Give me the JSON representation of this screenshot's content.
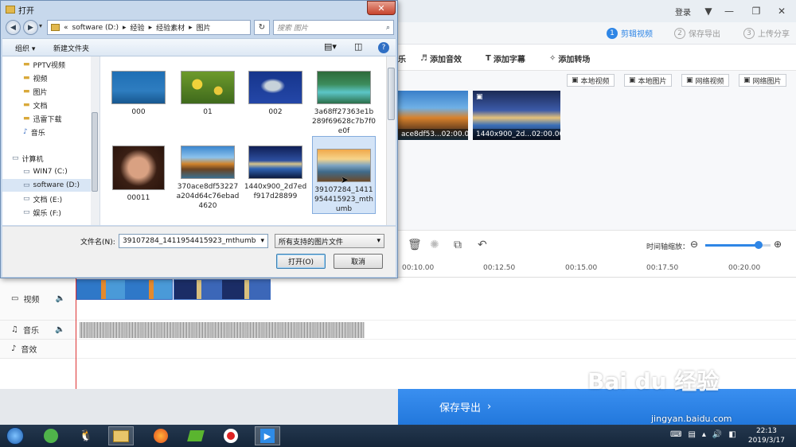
{
  "app": {
    "login": "登录",
    "steps": [
      {
        "num": "1",
        "label": "剪辑视频",
        "active": true
      },
      {
        "num": "2",
        "label": "保存导出",
        "active": false
      },
      {
        "num": "3",
        "label": "上传分享",
        "active": false
      }
    ],
    "tools": {
      "partial": "乐",
      "audio": "添加音效",
      "subtitle": "添加字幕",
      "transition": "添加转场"
    },
    "sources": [
      "本地视频",
      "本地图片",
      "网络视频",
      "网络图片"
    ],
    "media": [
      {
        "name": "ace8df53...",
        "duration": "02:00.00"
      },
      {
        "name": "1440x900_2d...",
        "duration": "02:00.00"
      }
    ],
    "zoom_label": "时间轴缩放：",
    "zoom_level": 0.82,
    "ruler": [
      "00:10.00",
      "00:12.50",
      "00:15.00",
      "00:17.50",
      "00:20.00"
    ],
    "tracks": {
      "video": "视频",
      "music": "音乐",
      "sfx": "音效"
    },
    "save_export": "保存导出"
  },
  "dialog": {
    "title": "打开",
    "path": [
      "software (D:)",
      "经验",
      "经验素材",
      "图片"
    ],
    "search_placeholder": "搜索 图片",
    "organize": "组织 ▾",
    "new_folder": "新建文件夹",
    "nav": [
      {
        "label": "PPTV视频",
        "icon": "folder-icon",
        "type": "fav"
      },
      {
        "label": "视频",
        "icon": "folder-icon",
        "type": "fav"
      },
      {
        "label": "图片",
        "icon": "folder-icon",
        "type": "fav"
      },
      {
        "label": "文档",
        "icon": "folder-icon",
        "type": "fav"
      },
      {
        "label": "迅雷下载",
        "icon": "folder-icon",
        "type": "fav"
      },
      {
        "label": "音乐",
        "icon": "music-icon",
        "type": "fav"
      },
      {
        "label": "计算机",
        "icon": "computer-icon",
        "type": "comp"
      },
      {
        "label": "WIN7 (C:)",
        "icon": "drive-icon",
        "type": "drive"
      },
      {
        "label": "software (D:)",
        "icon": "drive-icon",
        "type": "drive",
        "selected": true
      },
      {
        "label": "文档 (E:)",
        "icon": "drive-icon",
        "type": "drive"
      },
      {
        "label": "娱乐 (F:)",
        "icon": "drive-icon",
        "type": "drive"
      }
    ],
    "files": [
      {
        "name": "000",
        "style": "girl-blue"
      },
      {
        "name": "01",
        "style": "flowers"
      },
      {
        "name": "002",
        "style": "fish"
      },
      {
        "name": "3a68ff27363e1b289f69628c7b7f0e0f",
        "style": "river"
      },
      {
        "name": "00011",
        "style": "portrait"
      },
      {
        "name": "370ace8df53227a204d64c76ebad4620",
        "style": "mountain"
      },
      {
        "name": "1440x900_2d7edf917d28899",
        "style": "night"
      },
      {
        "name": "39107284_1411954415923_mthumb",
        "style": "sunset",
        "selected": true
      }
    ],
    "filename_label": "文件名(N):",
    "filename_value": "39107284_1411954415923_mthumb",
    "filetype_value": "所有支持的图片文件",
    "open_button": "打开(O)",
    "cancel_button": "取消"
  },
  "taskbar": {
    "time": "22:13",
    "date": "2019/3/17"
  },
  "watermark": {
    "brand": "Bai du 经验",
    "url": "jingyan.baidu.com"
  }
}
